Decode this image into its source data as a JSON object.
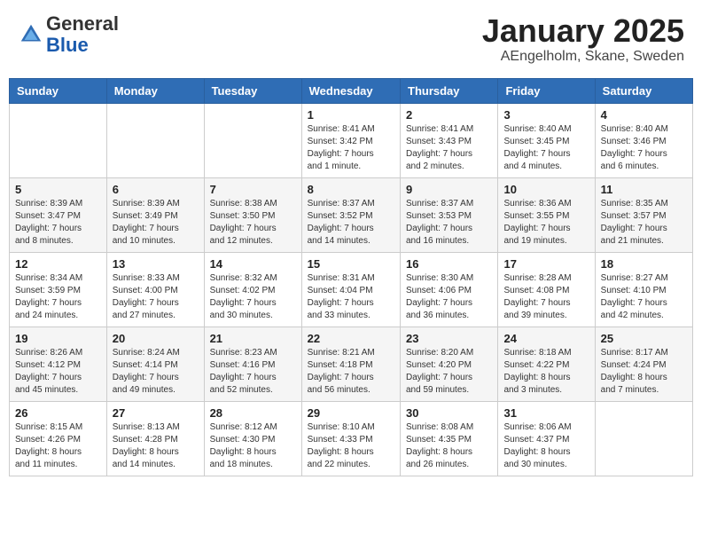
{
  "header": {
    "logo_general": "General",
    "logo_blue": "Blue",
    "month_title": "January 2025",
    "location": "AEngelholm, Skane, Sweden"
  },
  "days_of_week": [
    "Sunday",
    "Monday",
    "Tuesday",
    "Wednesday",
    "Thursday",
    "Friday",
    "Saturday"
  ],
  "weeks": [
    [
      {
        "day": "",
        "info": ""
      },
      {
        "day": "",
        "info": ""
      },
      {
        "day": "",
        "info": ""
      },
      {
        "day": "1",
        "info": "Sunrise: 8:41 AM\nSunset: 3:42 PM\nDaylight: 7 hours\nand 1 minute."
      },
      {
        "day": "2",
        "info": "Sunrise: 8:41 AM\nSunset: 3:43 PM\nDaylight: 7 hours\nand 2 minutes."
      },
      {
        "day": "3",
        "info": "Sunrise: 8:40 AM\nSunset: 3:45 PM\nDaylight: 7 hours\nand 4 minutes."
      },
      {
        "day": "4",
        "info": "Sunrise: 8:40 AM\nSunset: 3:46 PM\nDaylight: 7 hours\nand 6 minutes."
      }
    ],
    [
      {
        "day": "5",
        "info": "Sunrise: 8:39 AM\nSunset: 3:47 PM\nDaylight: 7 hours\nand 8 minutes."
      },
      {
        "day": "6",
        "info": "Sunrise: 8:39 AM\nSunset: 3:49 PM\nDaylight: 7 hours\nand 10 minutes."
      },
      {
        "day": "7",
        "info": "Sunrise: 8:38 AM\nSunset: 3:50 PM\nDaylight: 7 hours\nand 12 minutes."
      },
      {
        "day": "8",
        "info": "Sunrise: 8:37 AM\nSunset: 3:52 PM\nDaylight: 7 hours\nand 14 minutes."
      },
      {
        "day": "9",
        "info": "Sunrise: 8:37 AM\nSunset: 3:53 PM\nDaylight: 7 hours\nand 16 minutes."
      },
      {
        "day": "10",
        "info": "Sunrise: 8:36 AM\nSunset: 3:55 PM\nDaylight: 7 hours\nand 19 minutes."
      },
      {
        "day": "11",
        "info": "Sunrise: 8:35 AM\nSunset: 3:57 PM\nDaylight: 7 hours\nand 21 minutes."
      }
    ],
    [
      {
        "day": "12",
        "info": "Sunrise: 8:34 AM\nSunset: 3:59 PM\nDaylight: 7 hours\nand 24 minutes."
      },
      {
        "day": "13",
        "info": "Sunrise: 8:33 AM\nSunset: 4:00 PM\nDaylight: 7 hours\nand 27 minutes."
      },
      {
        "day": "14",
        "info": "Sunrise: 8:32 AM\nSunset: 4:02 PM\nDaylight: 7 hours\nand 30 minutes."
      },
      {
        "day": "15",
        "info": "Sunrise: 8:31 AM\nSunset: 4:04 PM\nDaylight: 7 hours\nand 33 minutes."
      },
      {
        "day": "16",
        "info": "Sunrise: 8:30 AM\nSunset: 4:06 PM\nDaylight: 7 hours\nand 36 minutes."
      },
      {
        "day": "17",
        "info": "Sunrise: 8:28 AM\nSunset: 4:08 PM\nDaylight: 7 hours\nand 39 minutes."
      },
      {
        "day": "18",
        "info": "Sunrise: 8:27 AM\nSunset: 4:10 PM\nDaylight: 7 hours\nand 42 minutes."
      }
    ],
    [
      {
        "day": "19",
        "info": "Sunrise: 8:26 AM\nSunset: 4:12 PM\nDaylight: 7 hours\nand 45 minutes."
      },
      {
        "day": "20",
        "info": "Sunrise: 8:24 AM\nSunset: 4:14 PM\nDaylight: 7 hours\nand 49 minutes."
      },
      {
        "day": "21",
        "info": "Sunrise: 8:23 AM\nSunset: 4:16 PM\nDaylight: 7 hours\nand 52 minutes."
      },
      {
        "day": "22",
        "info": "Sunrise: 8:21 AM\nSunset: 4:18 PM\nDaylight: 7 hours\nand 56 minutes."
      },
      {
        "day": "23",
        "info": "Sunrise: 8:20 AM\nSunset: 4:20 PM\nDaylight: 7 hours\nand 59 minutes."
      },
      {
        "day": "24",
        "info": "Sunrise: 8:18 AM\nSunset: 4:22 PM\nDaylight: 8 hours\nand 3 minutes."
      },
      {
        "day": "25",
        "info": "Sunrise: 8:17 AM\nSunset: 4:24 PM\nDaylight: 8 hours\nand 7 minutes."
      }
    ],
    [
      {
        "day": "26",
        "info": "Sunrise: 8:15 AM\nSunset: 4:26 PM\nDaylight: 8 hours\nand 11 minutes."
      },
      {
        "day": "27",
        "info": "Sunrise: 8:13 AM\nSunset: 4:28 PM\nDaylight: 8 hours\nand 14 minutes."
      },
      {
        "day": "28",
        "info": "Sunrise: 8:12 AM\nSunset: 4:30 PM\nDaylight: 8 hours\nand 18 minutes."
      },
      {
        "day": "29",
        "info": "Sunrise: 8:10 AM\nSunset: 4:33 PM\nDaylight: 8 hours\nand 22 minutes."
      },
      {
        "day": "30",
        "info": "Sunrise: 8:08 AM\nSunset: 4:35 PM\nDaylight: 8 hours\nand 26 minutes."
      },
      {
        "day": "31",
        "info": "Sunrise: 8:06 AM\nSunset: 4:37 PM\nDaylight: 8 hours\nand 30 minutes."
      },
      {
        "day": "",
        "info": ""
      }
    ]
  ]
}
